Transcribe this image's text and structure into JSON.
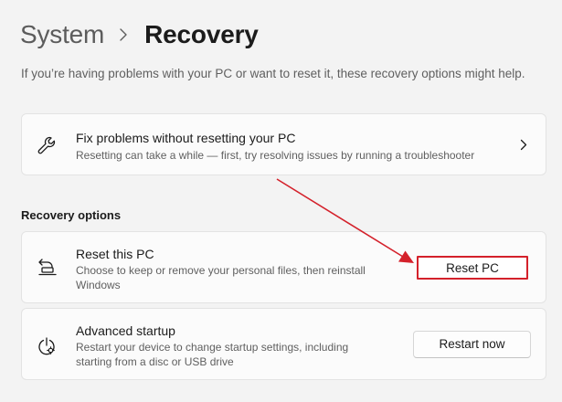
{
  "breadcrumb": {
    "parent": "System",
    "current": "Recovery"
  },
  "intro_text": "If you’re having problems with your PC or want to reset it, these recovery options might help.",
  "fix_card": {
    "title": "Fix problems without resetting your PC",
    "description": "Resetting can take a while — first, try resolving issues by running a troubleshooter",
    "icon": "wrench-icon"
  },
  "recovery_options": {
    "heading": "Recovery options",
    "reset": {
      "title": "Reset this PC",
      "description": "Choose to keep or remove your personal files, then reinstall Windows",
      "button_label": "Reset PC",
      "icon": "reset-pc-icon"
    },
    "advanced": {
      "title": "Advanced startup",
      "description": "Restart your device to change startup settings, including starting from a disc or USB drive",
      "button_label": "Restart now",
      "icon": "advanced-startup-icon"
    }
  },
  "colors": {
    "background": "#f3f3f3",
    "card": "#fbfbfb",
    "annotation": "#d4212b"
  }
}
